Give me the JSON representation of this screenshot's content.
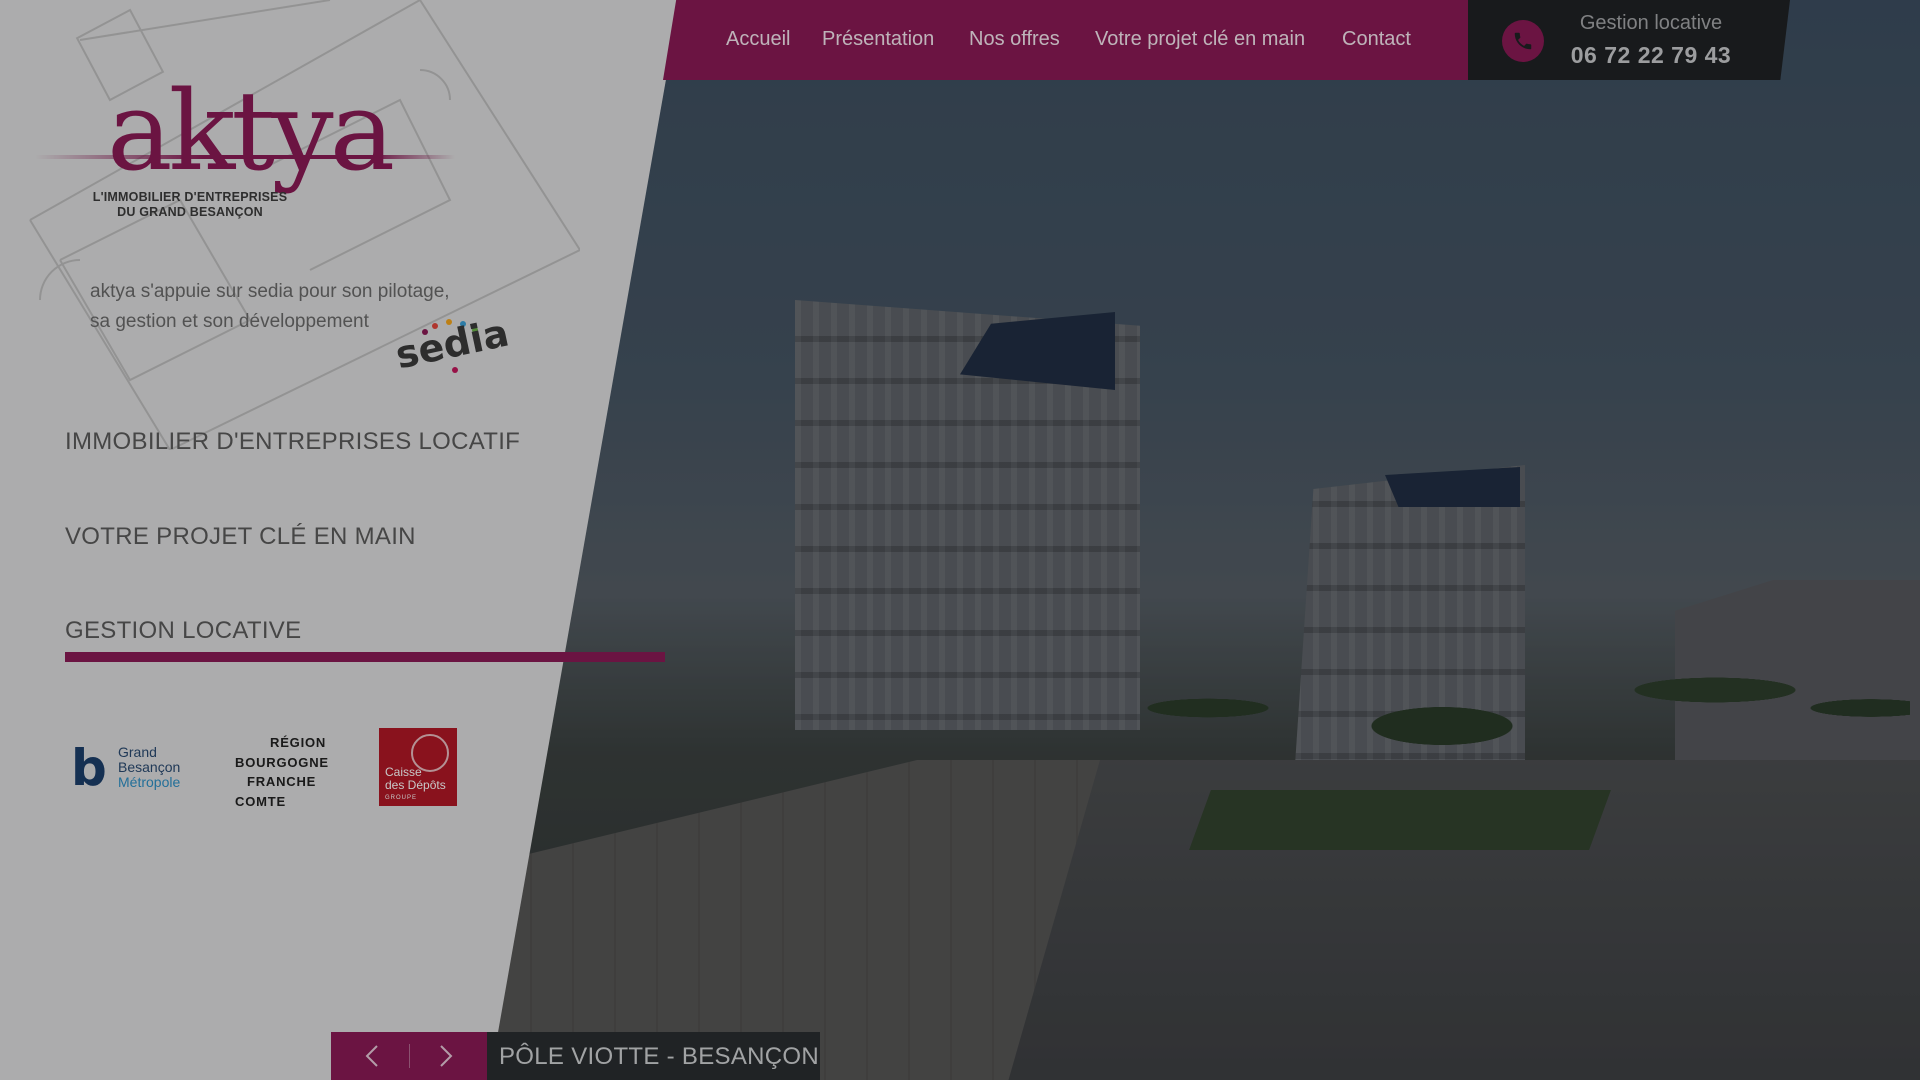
{
  "brand": {
    "logo_word": "aktya",
    "tagline_line1": "L'IMMOBILIER D'ENTREPRISES",
    "tagline_line2": "DU GRAND BESANÇON",
    "accent_color": "#8a1a55"
  },
  "nav": {
    "items": [
      {
        "label": "Accueil"
      },
      {
        "label": "Présentation"
      },
      {
        "label": "Nos offres"
      },
      {
        "label": "Votre projet clé en main"
      },
      {
        "label": "Contact"
      }
    ]
  },
  "contact": {
    "label": "Gestion locative",
    "phone": "06 72 22 79 43",
    "icon": "phone-icon"
  },
  "intro": {
    "line1": "aktya s'appuie sur sedia pour son pilotage,",
    "line2": "sa gestion et son développement",
    "partner_logo": "sedia"
  },
  "side_menu": {
    "items": [
      {
        "label": "IMMOBILIER D'ENTREPRISES LOCATIF"
      },
      {
        "label": "VOTRE PROJET CLÉ EN MAIN"
      },
      {
        "label": "GESTION LOCATIVE",
        "active": true
      }
    ]
  },
  "partners": {
    "gbm": {
      "mark": "b",
      "line1": "Grand",
      "line2": "Besançon",
      "line3": "Métropole"
    },
    "region": {
      "line1": "RÉGION",
      "line2": "BOURGOGNE",
      "line3": "FRANCHE",
      "line4": "COMTE"
    },
    "cdc": {
      "line1": "Caisse",
      "line2": "des Dépôts",
      "line3": "GROUPE"
    }
  },
  "slider": {
    "caption": "PÔLE VIOTTE - BESANÇON",
    "prev_icon": "chevron-left-icon",
    "next_icon": "chevron-right-icon"
  }
}
